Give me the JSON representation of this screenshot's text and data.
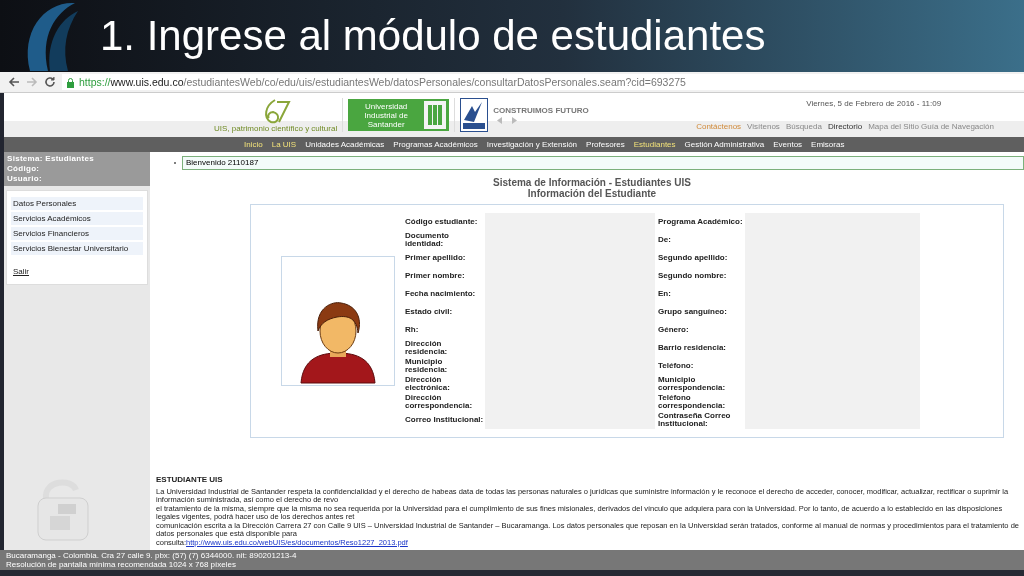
{
  "slide": {
    "title": "1. Ingrese al módulo de estudiantes"
  },
  "browser": {
    "url": {
      "scheme": "https://",
      "host": "www.uis.edu.co",
      "path": "/estudiantesWeb/co/edu/uis/estudiantesWeb/datosPersonales/consultarDatosPersonales.seam?cid=693275"
    }
  },
  "header": {
    "anniversary_caption": "UIS, patrimonio científico y cultural",
    "university_name": "Universidad Industrial de Santander",
    "slogan": "CONSTRUIMOS FUTURO",
    "date": "Viernes, 5 de Febrero de 2016 - 11:09"
  },
  "top_links": [
    {
      "label": "Contáctenos",
      "kind": "accent"
    },
    {
      "label": "Visítenos",
      "kind": "plain"
    },
    {
      "label": "Búsqueda",
      "kind": "plain"
    },
    {
      "label": "Directorio",
      "kind": "strong"
    },
    {
      "label": "Mapa del Sitio Guía de Navegación",
      "kind": "plain"
    }
  ],
  "main_nav": [
    {
      "label": "Inicio",
      "selected": true
    },
    {
      "label": "La UIS",
      "selected": true
    },
    {
      "label": "Unidades Académicas",
      "selected": false
    },
    {
      "label": "Programas Académicos",
      "selected": false
    },
    {
      "label": "Investigación y Extensión",
      "selected": false
    },
    {
      "label": "Profesores",
      "selected": false
    },
    {
      "label": "Estudiantes",
      "selected": true
    },
    {
      "label": "Gestión Administrativa",
      "selected": false
    },
    {
      "label": "Eventos",
      "selected": false
    },
    {
      "label": "Emisoras",
      "selected": false
    }
  ],
  "sidebar": {
    "info": [
      "Sistema: Estudiantes",
      "Código:",
      "Usuario:"
    ],
    "menu": [
      "Datos Personales",
      "Servicios Académicos",
      "Servicios Financieros",
      "Servicios Bienestar Universitario"
    ],
    "logout": "Salir"
  },
  "welcome": "Bienvenido 2110187",
  "content": {
    "title": "Sistema de Información - Estudiantes UIS",
    "subtitle": "Información del Estudiante",
    "fields": [
      [
        "Código estudiante:",
        "Programa Académico:"
      ],
      [
        "Documento identidad:",
        "De:"
      ],
      [
        "Primer apellido:",
        "Segundo apellido:"
      ],
      [
        "Primer nombre:",
        "Segundo nombre:"
      ],
      [
        "Fecha nacimiento:",
        "En:"
      ],
      [
        "Estado civil:",
        "Grupo sanguíneo:"
      ],
      [
        "Rh:",
        "Género:"
      ],
      [
        "Dirección residencia:",
        "Barrio residencia:"
      ],
      [
        "Municipio residencia:",
        "Teléfono:"
      ],
      [
        "Dirección electrónica:",
        "Municipio correspondencia:"
      ],
      [
        "Dirección correspondencia:",
        "Teléfono correspondencia:"
      ],
      [
        "Correo Institucional:",
        "Contraseña Correo Institucional:"
      ]
    ]
  },
  "notice": {
    "title": "ESTUDIANTE UIS",
    "lines": [
      "La Universidad Industrial de Santander respeta la confidencialidad y el derecho de habeas data de todas las personas naturales o jurídicas que suministre información y le reconoce el derecho de acceder, conocer, modificar, actualizar, rectificar o suprimir la información suministrada, así como el derecho de revo",
      "el tratamiento de la misma, siempre que la misma no sea requerida por la Universidad para el cumplimiento de sus fines misionales, derivados del vínculo que adquiera para con la Universidad. Por lo tanto, de acuerdo a lo establecido en las disposiciones legales vigentes, podrá hacer uso de los derechos antes ret",
      "comunicación escrita a la Dirección Carrera 27 con Calle 9 UIS – Universidad Industrial de Santander – Bucaramanga. Los datos personales que reposan en la Universidad serán tratados, conforme al manual de normas y procedimientos para el tratamiento de datos personales que está disponible para"
    ],
    "last_prefix": "consulta:",
    "link": "http://www.uis.edu.co/webUIS/es/documentos/Reso1227_2013.pdf"
  },
  "footer": [
    "Bucaramanga - Colombia. Cra 27 calle 9. pbx: (57) (7) 6344000. nit: 890201213-4",
    "Resolución de pantalla mínima recomendada 1024 x 768 píxeles"
  ]
}
